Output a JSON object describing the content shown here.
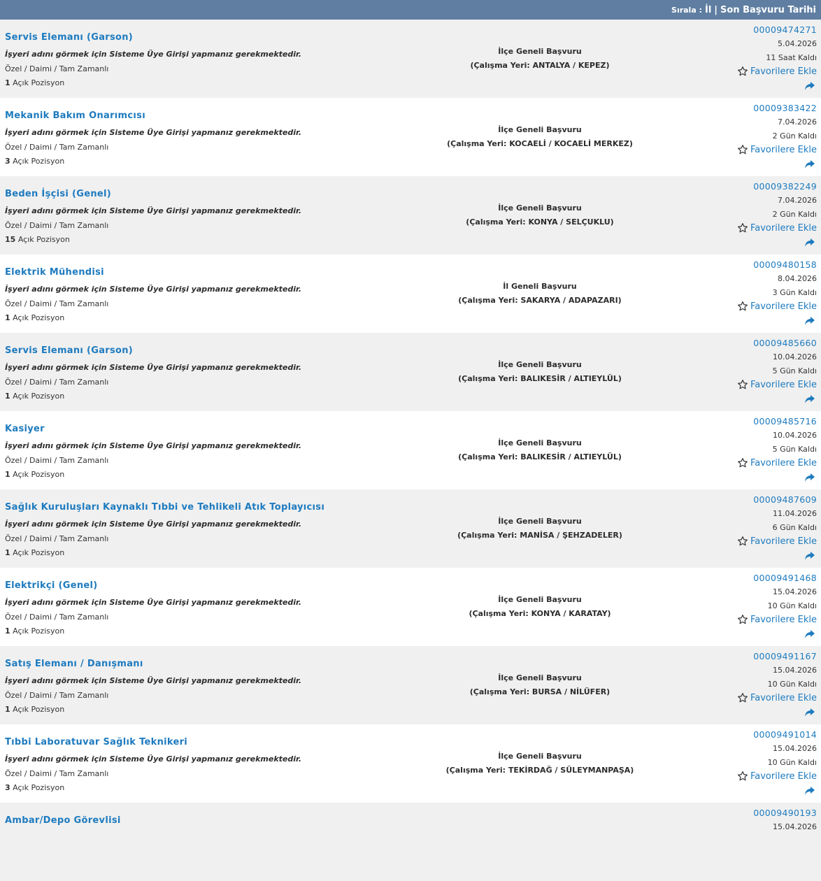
{
  "sort": {
    "label": "Sırala :",
    "option_city": "İl",
    "separator": "|",
    "option_deadline": "Son Başvuru Tarihi"
  },
  "jobs": [
    {
      "title": "Servis Elemanı (Garson)",
      "employer_note": "İşyeri adını görmek için Sisteme Üye Girişi yapmanız gerekmektedir.",
      "type": "Özel / Daimi / Tam Zamanlı",
      "positions": "1",
      "positions_label": "Açık Pozisyon",
      "scope": "İlçe Geneli Başvuru",
      "location": "(Çalışma Yeri: ANTALYA / KEPEZ)",
      "id": "00009474271",
      "date": "5.04.2026",
      "remaining": "11 Saat Kaldı",
      "fav_label": "Favorilere Ekle"
    },
    {
      "title": "Mekanik Bakım Onarımcısı",
      "employer_note": "İşyeri adını görmek için Sisteme Üye Girişi yapmanız gerekmektedir.",
      "type": "Özel / Daimi / Tam Zamanlı",
      "positions": "3",
      "positions_label": "Açık Pozisyon",
      "scope": "İlçe Geneli Başvuru",
      "location": "(Çalışma Yeri: KOCAELİ / KOCAELİ MERKEZ)",
      "id": "00009383422",
      "date": "7.04.2026",
      "remaining": "2 Gün Kaldı",
      "fav_label": "Favorilere Ekle"
    },
    {
      "title": "Beden İşçisi (Genel)",
      "employer_note": "İşyeri adını görmek için Sisteme Üye Girişi yapmanız gerekmektedir.",
      "type": "Özel / Daimi / Tam Zamanlı",
      "positions": "15",
      "positions_label": "Açık Pozisyon",
      "scope": "İlçe Geneli Başvuru",
      "location": "(Çalışma Yeri: KONYA / SELÇUKLU)",
      "id": "00009382249",
      "date": "7.04.2026",
      "remaining": "2 Gün Kaldı",
      "fav_label": "Favorilere Ekle"
    },
    {
      "title": "Elektrik Mühendisi",
      "employer_note": "İşyeri adını görmek için Sisteme Üye Girişi yapmanız gerekmektedir.",
      "type": "Özel / Daimi / Tam Zamanlı",
      "positions": "1",
      "positions_label": "Açık Pozisyon",
      "scope": "İl Geneli Başvuru",
      "location": "(Çalışma Yeri: SAKARYA / ADAPAZARI)",
      "id": "00009480158",
      "date": "8.04.2026",
      "remaining": "3 Gün Kaldı",
      "fav_label": "Favorilere Ekle"
    },
    {
      "title": "Servis Elemanı (Garson)",
      "employer_note": "İşyeri adını görmek için Sisteme Üye Girişi yapmanız gerekmektedir.",
      "type": "Özel / Daimi / Tam Zamanlı",
      "positions": "1",
      "positions_label": "Açık Pozisyon",
      "scope": "İlçe Geneli Başvuru",
      "location": "(Çalışma Yeri: BALIKESİR / ALTIEYLÜL)",
      "id": "00009485660",
      "date": "10.04.2026",
      "remaining": "5 Gün Kaldı",
      "fav_label": "Favorilere Ekle"
    },
    {
      "title": "Kasiyer",
      "employer_note": "İşyeri adını görmek için Sisteme Üye Girişi yapmanız gerekmektedir.",
      "type": "Özel / Daimi / Tam Zamanlı",
      "positions": "1",
      "positions_label": "Açık Pozisyon",
      "scope": "İlçe Geneli Başvuru",
      "location": "(Çalışma Yeri: BALIKESİR / ALTIEYLÜL)",
      "id": "00009485716",
      "date": "10.04.2026",
      "remaining": "5 Gün Kaldı",
      "fav_label": "Favorilere Ekle"
    },
    {
      "title": "Sağlık Kuruluşları Kaynaklı Tıbbi ve Tehlikeli Atık Toplayıcısı",
      "employer_note": "İşyeri adını görmek için Sisteme Üye Girişi yapmanız gerekmektedir.",
      "type": "Özel / Daimi / Tam Zamanlı",
      "positions": "1",
      "positions_label": "Açık Pozisyon",
      "scope": "İlçe Geneli Başvuru",
      "location": "(Çalışma Yeri: MANİSA / ŞEHZADELER)",
      "id": "00009487609",
      "date": "11.04.2026",
      "remaining": "6 Gün Kaldı",
      "fav_label": "Favorilere Ekle"
    },
    {
      "title": "Elektrikçi (Genel)",
      "employer_note": "İşyeri adını görmek için Sisteme Üye Girişi yapmanız gerekmektedir.",
      "type": "Özel / Daimi / Tam Zamanlı",
      "positions": "1",
      "positions_label": "Açık Pozisyon",
      "scope": "İlçe Geneli Başvuru",
      "location": "(Çalışma Yeri: KONYA / KARATAY)",
      "id": "00009491468",
      "date": "15.04.2026",
      "remaining": "10 Gün Kaldı",
      "fav_label": "Favorilere Ekle"
    },
    {
      "title": "Satış Elemanı / Danışmanı",
      "employer_note": "İşyeri adını görmek için Sisteme Üye Girişi yapmanız gerekmektedir.",
      "type": "Özel / Daimi / Tam Zamanlı",
      "positions": "1",
      "positions_label": "Açık Pozisyon",
      "scope": "İlçe Geneli Başvuru",
      "location": "(Çalışma Yeri: BURSA / NİLÜFER)",
      "id": "00009491167",
      "date": "15.04.2026",
      "remaining": "10 Gün Kaldı",
      "fav_label": "Favorilere Ekle"
    },
    {
      "title": "Tıbbi Laboratuvar Sağlık Teknikeri",
      "employer_note": "İşyeri adını görmek için Sisteme Üye Girişi yapmanız gerekmektedir.",
      "type": "Özel / Daimi / Tam Zamanlı",
      "positions": "3",
      "positions_label": "Açık Pozisyon",
      "scope": "İlçe Geneli Başvuru",
      "location": "(Çalışma Yeri: TEKİRDAĞ / SÜLEYMANPAŞA)",
      "id": "00009491014",
      "date": "15.04.2026",
      "remaining": "10 Gün Kaldı",
      "fav_label": "Favorilere Ekle"
    },
    {
      "title": "Ambar/Depo Görevlisi",
      "employer_note": "",
      "type": "",
      "positions": "",
      "positions_label": "",
      "scope": "",
      "location": "",
      "id": "00009490193",
      "date": "15.04.2026",
      "remaining": "",
      "fav_label": ""
    }
  ]
}
